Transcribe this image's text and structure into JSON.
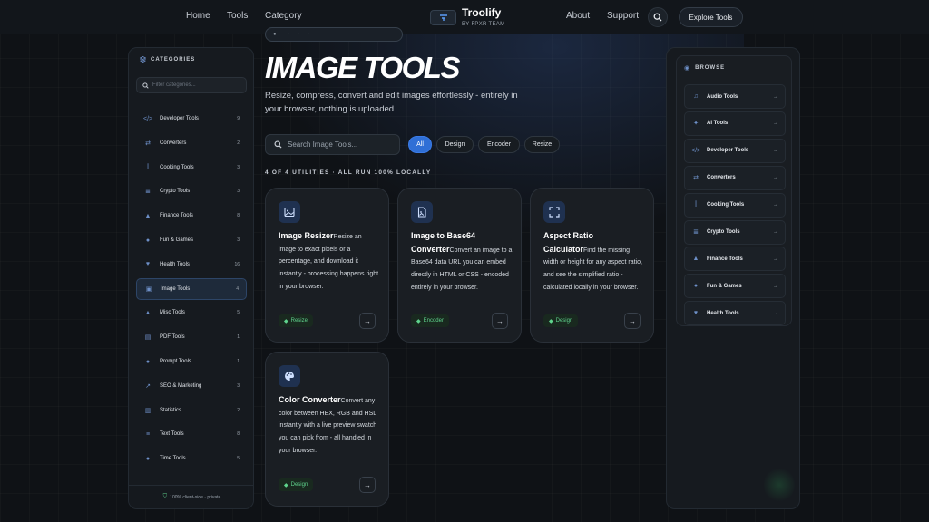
{
  "nav": {
    "links": [
      "Home",
      "Tools",
      "Category",
      "About",
      "Support"
    ],
    "brand_name": "Troolify",
    "brand_sub": "BY FPXR TEAM",
    "explore_label": "Explore Tools"
  },
  "sidebar": {
    "heading": "CATEGORIES",
    "filter_placeholder": "Filter categories...",
    "items": [
      {
        "label": "Developer Tools",
        "count": "9",
        "icon": "code-icon",
        "glyph": "</>"
      },
      {
        "label": "Converters",
        "count": "2",
        "icon": "convert-icon",
        "glyph": "⇄"
      },
      {
        "label": "Cooking Tools",
        "count": "3",
        "icon": "utensils-icon",
        "glyph": "ꟾ"
      },
      {
        "label": "Crypto Tools",
        "count": "3",
        "icon": "coins-icon",
        "glyph": "≣"
      },
      {
        "label": "Finance Tools",
        "count": "8",
        "icon": "finance-icon",
        "glyph": "▲"
      },
      {
        "label": "Fun & Games",
        "count": "3",
        "icon": "games-icon",
        "glyph": "●"
      },
      {
        "label": "Health Tools",
        "count": "16",
        "icon": "heart-icon",
        "glyph": "♥"
      },
      {
        "label": "Image Tools",
        "count": "4",
        "icon": "image-icon",
        "glyph": "▣",
        "active": true
      },
      {
        "label": "Misc Tools",
        "count": "5",
        "icon": "shapes-icon",
        "glyph": "▲"
      },
      {
        "label": "PDF Tools",
        "count": "1",
        "icon": "pdf-icon",
        "glyph": "▤"
      },
      {
        "label": "Prompt Tools",
        "count": "1",
        "icon": "chat-icon",
        "glyph": "●"
      },
      {
        "label": "SEO & Marketing",
        "count": "3",
        "icon": "chart-icon",
        "glyph": "↗"
      },
      {
        "label": "Statistics",
        "count": "2",
        "icon": "stats-icon",
        "glyph": "▥"
      },
      {
        "label": "Text Tools",
        "count": "8",
        "icon": "text-icon",
        "glyph": "≡"
      },
      {
        "label": "Time Tools",
        "count": "5",
        "icon": "clock-icon",
        "glyph": "●"
      }
    ],
    "footer": "100% client-side · private"
  },
  "main": {
    "title": "IMAGE TOOLS",
    "subtitle": "Resize, compress, convert and edit images effortlessly - entirely in your browser, nothing is uploaded.",
    "search_placeholder": "Search Image Tools...",
    "filters": [
      "All",
      "Design",
      "Encoder",
      "Resize"
    ],
    "result_count": "4 OF 4 UTILITIES · ALL RUN 100% LOCALLY",
    "cards": [
      {
        "title": "Image Resizer",
        "desc": "Resize an image to exact pixels or a percentage, and download it instantly - processing happens right in your browser.",
        "tag": "Resize",
        "icon": "image-icon"
      },
      {
        "title": "Image to Base64 Converter",
        "desc": "Convert an image to a Base64 data URL you can embed directly in HTML or CSS - encoded entirely in your browser.",
        "tag": "Encoder",
        "icon": "file-image-icon"
      },
      {
        "title": "Aspect Ratio Calculator",
        "desc": "Find the missing width or height for any aspect ratio, and see the simplified ratio - calculated locally in your browser.",
        "tag": "Design",
        "icon": "expand-icon"
      },
      {
        "title": "Color Converter",
        "desc": "Convert any color between HEX, RGB and HSL instantly with a live preview swatch you can pick from - all handled in your browser.",
        "tag": "Design",
        "icon": "palette-icon"
      }
    ]
  },
  "browse": {
    "heading": "BROWSE",
    "items": [
      {
        "label": "Audio Tools",
        "glyph": "♫"
      },
      {
        "label": "AI Tools",
        "glyph": "✦"
      },
      {
        "label": "Developer Tools",
        "glyph": "</>"
      },
      {
        "label": "Converters",
        "glyph": "⇄"
      },
      {
        "label": "Cooking Tools",
        "glyph": "ꟾ"
      },
      {
        "label": "Crypto Tools",
        "glyph": "≣"
      },
      {
        "label": "Finance Tools",
        "glyph": "▲"
      },
      {
        "label": "Fun & Games",
        "glyph": "●"
      },
      {
        "label": "Health Tools",
        "glyph": "♥"
      }
    ]
  },
  "colors": {
    "accent": "#2f6fd6",
    "tag_green": "#5fd38d",
    "bg": "#0f1216"
  }
}
